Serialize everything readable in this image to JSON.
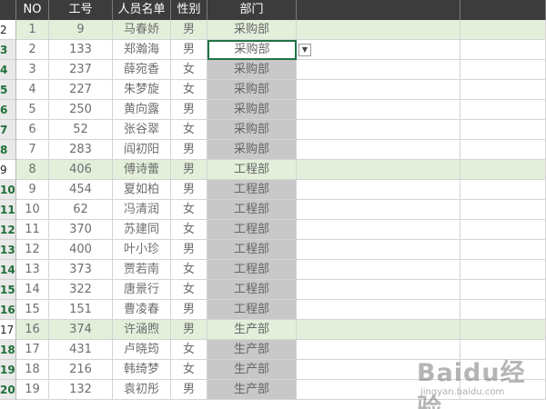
{
  "header": {
    "cols": [
      "NO",
      "工号",
      "人员名单",
      "性别",
      "部门"
    ]
  },
  "top_row_number": "2",
  "rows": [
    {
      "rownum": "3",
      "no": "2",
      "id": "133",
      "name": "郑瀚海",
      "gender": "男",
      "dept": "采购部",
      "state": "selected"
    },
    {
      "rownum": "4",
      "no": "3",
      "id": "237",
      "name": "薛宛香",
      "gender": "女",
      "dept": "采购部",
      "state": "grouped"
    },
    {
      "rownum": "5",
      "no": "4",
      "id": "227",
      "name": "朱梦旋",
      "gender": "女",
      "dept": "采购部",
      "state": "grouped"
    },
    {
      "rownum": "6",
      "no": "5",
      "id": "250",
      "name": "黄向露",
      "gender": "男",
      "dept": "采购部",
      "state": "grouped"
    },
    {
      "rownum": "7",
      "no": "6",
      "id": "52",
      "name": "张谷翠",
      "gender": "女",
      "dept": "采购部",
      "state": "grouped"
    },
    {
      "rownum": "8",
      "no": "7",
      "id": "283",
      "name": "阎初阳",
      "gender": "男",
      "dept": "采购部",
      "state": "grouped"
    },
    {
      "rownum": "9",
      "no": "8",
      "id": "406",
      "name": "傅诗蕾",
      "gender": "男",
      "dept": "工程部",
      "state": "highlight"
    },
    {
      "rownum": "10",
      "no": "9",
      "id": "454",
      "name": "夏如柏",
      "gender": "男",
      "dept": "工程部",
      "state": "grouped"
    },
    {
      "rownum": "11",
      "no": "10",
      "id": "62",
      "name": "冯清润",
      "gender": "女",
      "dept": "工程部",
      "state": "grouped"
    },
    {
      "rownum": "12",
      "no": "11",
      "id": "370",
      "name": "苏建同",
      "gender": "女",
      "dept": "工程部",
      "state": "grouped"
    },
    {
      "rownum": "13",
      "no": "12",
      "id": "400",
      "name": "叶小珍",
      "gender": "男",
      "dept": "工程部",
      "state": "grouped"
    },
    {
      "rownum": "14",
      "no": "13",
      "id": "373",
      "name": "贾若南",
      "gender": "女",
      "dept": "工程部",
      "state": "grouped"
    },
    {
      "rownum": "15",
      "no": "14",
      "id": "322",
      "name": "唐景行",
      "gender": "女",
      "dept": "工程部",
      "state": "grouped"
    },
    {
      "rownum": "16",
      "no": "15",
      "id": "151",
      "name": "曹凌春",
      "gender": "男",
      "dept": "工程部",
      "state": "grouped"
    },
    {
      "rownum": "17",
      "no": "16",
      "id": "374",
      "name": "许涵煦",
      "gender": "男",
      "dept": "生产部",
      "state": "highlight"
    },
    {
      "rownum": "18",
      "no": "17",
      "id": "431",
      "name": "卢晓筠",
      "gender": "女",
      "dept": "生产部",
      "state": "grouped"
    },
    {
      "rownum": "19",
      "no": "18",
      "id": "216",
      "name": "韩绮梦",
      "gender": "女",
      "dept": "生产部",
      "state": "grouped"
    },
    {
      "rownum": "20",
      "no": "19",
      "id": "132",
      "name": "袁初彤",
      "gender": "男",
      "dept": "生产部",
      "state": "grouped"
    }
  ],
  "first_row": {
    "rownum": "2",
    "no": "1",
    "id": "9",
    "name": "马春娇",
    "gender": "男",
    "dept": "采购部"
  },
  "dropdown_icon": "dropdown-arrow-icon",
  "watermark": {
    "logo": "Baidu经验",
    "sub": "jingyan.baidu.com"
  },
  "colors": {
    "header_bg": "#3c3c3c",
    "highlight_row": "#e3efda",
    "dept_fill": "#c8c8c8",
    "rownum_text": "#1f6f3a"
  }
}
